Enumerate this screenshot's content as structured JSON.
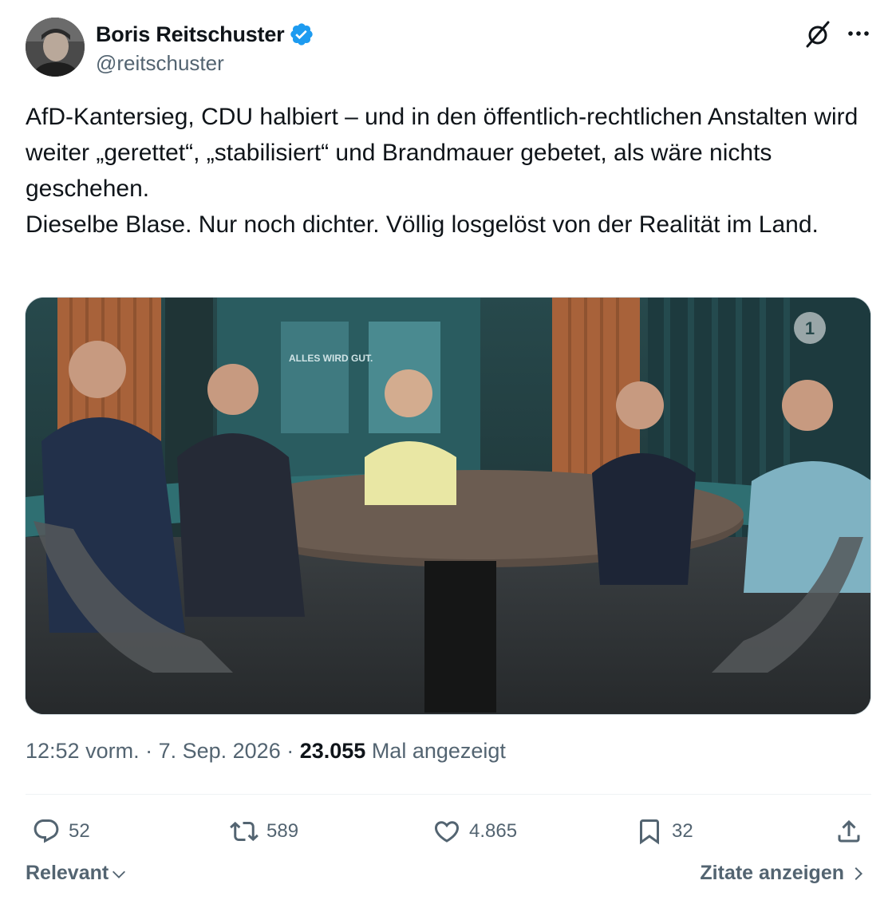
{
  "author": {
    "display_name": "Boris Reitschuster",
    "handle": "@reitschuster",
    "verified": true,
    "verified_color": "#1d9bf0"
  },
  "tweet": {
    "text": "AfD-Kantersieg, CDU halbiert – und in den öffentlich-rechtlichen Anstalten wird weiter „gerettet“, „stabilisiert“ und Brandmauer gebetet, als wäre nichts geschehen.\nDieselbe Blase. Nur noch dichter. Völlig losgelöst von der Realität im Land."
  },
  "media": {
    "watermark": "1",
    "poster_text": "ALLES WIRD GUT."
  },
  "meta": {
    "time": "12:52 vorm.",
    "separator": " · ",
    "date": "7. Sep. 2026",
    "separator2": " · ",
    "views_count": "23.055",
    "views_label": " Mal angezeigt"
  },
  "actions": {
    "replies": "52",
    "retweets": "589",
    "likes": "4.865",
    "bookmarks": "32"
  },
  "footer": {
    "sort_label": "Relevant",
    "quotes_label": "Zitate anzeigen"
  },
  "icons": {
    "grok": "grok-icon",
    "more": "more-icon",
    "reply": "reply-icon",
    "retweet": "retweet-icon",
    "like": "heart-icon",
    "bookmark": "bookmark-icon",
    "share": "share-icon"
  },
  "colors": {
    "text_primary": "#0f1419",
    "text_secondary": "#536471",
    "accent": "#1d9bf0"
  }
}
